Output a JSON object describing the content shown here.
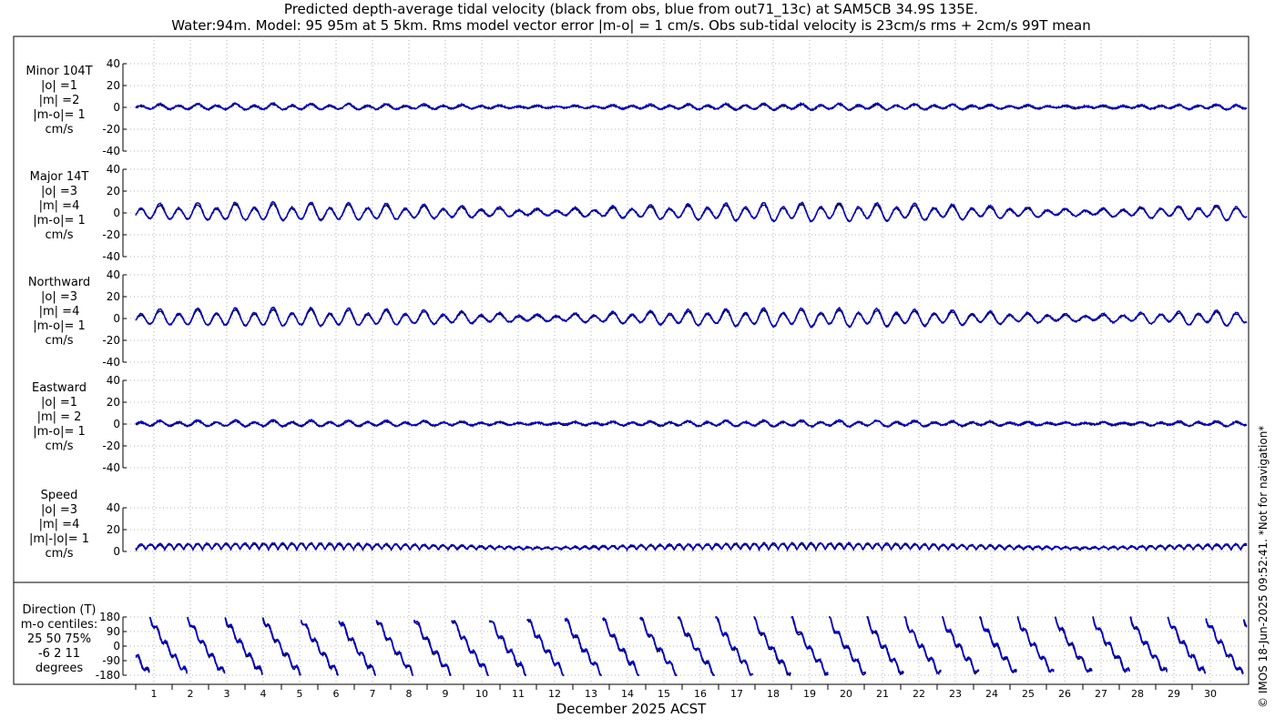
{
  "title": {
    "line1": "Predicted depth-average tidal velocity (black from obs, blue from out71_13c) at SAM5CB 34.9S 135E.",
    "line2": "Water:94m. Model: 95 95m at 5 5km. Rms model vector error |m-o| = 1 cm/s. Obs sub-tidal velocity is 23cm/s rms + 2cm/s 99T mean"
  },
  "credit": "© IMOS 18-Jun-2025 09:52:41. *Not for navigation*",
  "xlabel": "December 2025 ACST",
  "colors": {
    "obs": "#000000",
    "model": "#0000cc",
    "grid": "#9a9a9a"
  },
  "chart_data": {
    "type": "line",
    "x_days": [
      "1",
      "2",
      "3",
      "4",
      "5",
      "6",
      "7",
      "8",
      "9",
      "10",
      "11",
      "12",
      "13",
      "14",
      "15",
      "16",
      "17",
      "18",
      "19",
      "20",
      "21",
      "22",
      "23",
      "24",
      "25",
      "26",
      "27",
      "28",
      "29",
      "30"
    ],
    "series_names": [
      "obs",
      "model"
    ],
    "grid": true,
    "panels": [
      {
        "id": "minor",
        "label": [
          "Minor 104T",
          "|o| =1",
          "|m| =2",
          "|m-o|= 1",
          "cm/s"
        ],
        "ylim": [
          -40,
          40
        ],
        "yticks": [
          "40",
          "20",
          "0",
          "-20",
          "-40"
        ],
        "amplitude": 2
      },
      {
        "id": "major",
        "label": [
          "Major 14T",
          "|o| =3",
          "|m| =4",
          "|m-o|= 1",
          "cm/s"
        ],
        "ylim": [
          -40,
          40
        ],
        "yticks": [
          "40",
          "20",
          "0",
          "-20",
          "-40"
        ],
        "amplitude": 6
      },
      {
        "id": "north",
        "label": [
          "Northward",
          "|o| =3",
          "|m| =4",
          "|m-o|= 1",
          "cm/s"
        ],
        "ylim": [
          -40,
          40
        ],
        "yticks": [
          "40",
          "20",
          "0",
          "-20",
          "-40"
        ],
        "amplitude": 6
      },
      {
        "id": "east",
        "label": [
          "Eastward",
          "|o| =1",
          "|m| = 2",
          "|m-o|= 1",
          "cm/s"
        ],
        "ylim": [
          -40,
          40
        ],
        "yticks": [
          "40",
          "20",
          "0",
          "-20",
          "-40"
        ],
        "amplitude": 2
      },
      {
        "id": "speed",
        "label": [
          "Speed",
          "|o| =3",
          "|m| =4",
          "|m|-|o|= 1",
          "cm/s"
        ],
        "ylim": [
          0,
          40
        ],
        "yticks": [
          "40",
          "20",
          "0"
        ],
        "amplitude": 4
      },
      {
        "id": "direction",
        "label": [
          "Direction (T)",
          "m-o centiles:",
          "25  50  75%",
          "-6   2  11",
          "degrees"
        ],
        "ylim": [
          -180,
          180
        ],
        "yticks": [
          "180",
          "90",
          "0",
          "-90",
          "-180"
        ]
      }
    ]
  }
}
